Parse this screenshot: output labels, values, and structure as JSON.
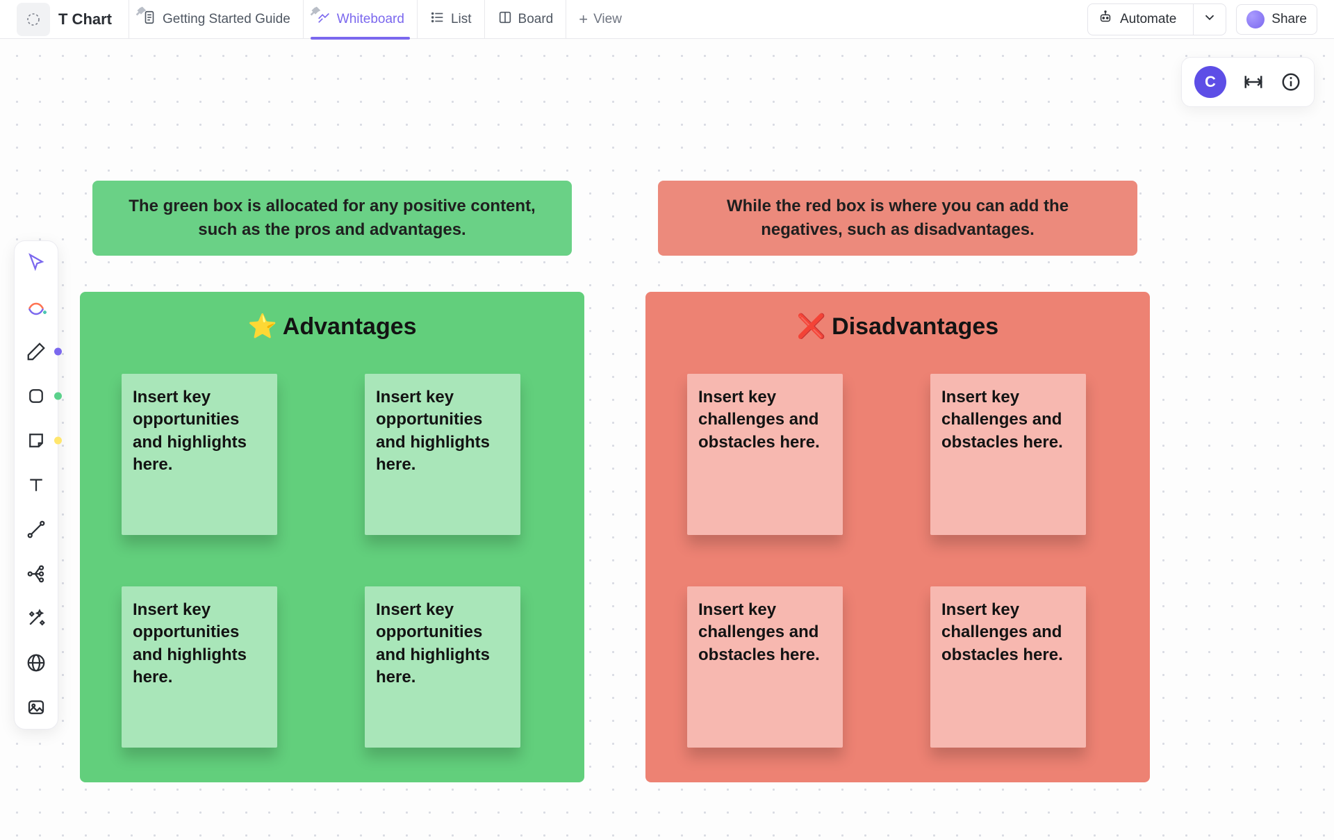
{
  "header": {
    "doc_title": "T Chart",
    "tabs": [
      {
        "label": "Getting Started Guide",
        "active": false
      },
      {
        "label": "Whiteboard",
        "active": true
      },
      {
        "label": "List",
        "active": false
      },
      {
        "label": "Board",
        "active": false
      }
    ],
    "add_view_label": "View",
    "automate_label": "Automate",
    "share_label": "Share"
  },
  "corner": {
    "avatar_initial": "C"
  },
  "toolbar": {
    "items": [
      "cursor",
      "ai-generate",
      "pen",
      "shape",
      "sticky",
      "text",
      "connector",
      "mindmap",
      "ai-magic",
      "web",
      "image"
    ]
  },
  "chart_data": {
    "type": "table",
    "title": "T Chart",
    "columns": [
      {
        "key": "advantages",
        "heading_icon": "⭐",
        "heading": "Advantages",
        "color": "#62cf7c",
        "description": "The green box is allocated for any positive content, such as the pros and advantages.",
        "card_placeholder": "Insert key opportunities and highlights here.",
        "cards": [
          "Insert key opportunities and highlights here.",
          "Insert key opportunities and highlights here.",
          "Insert key opportunities and highlights here.",
          "Insert key opportunities and highlights here."
        ]
      },
      {
        "key": "disadvantages",
        "heading_icon": "❌",
        "heading": "Disadvantages",
        "color": "#ed8273",
        "description": "While the red box is where you can add the negatives, such as disadvantages.",
        "card_placeholder": "Insert key challenges and obstacles here.",
        "cards": [
          "Insert key challenges and obstacles here.",
          "Insert key challenges and obstacles here.",
          "Insert key challenges and obstacles here.",
          "Insert key challenges and obstacles here."
        ]
      }
    ]
  }
}
